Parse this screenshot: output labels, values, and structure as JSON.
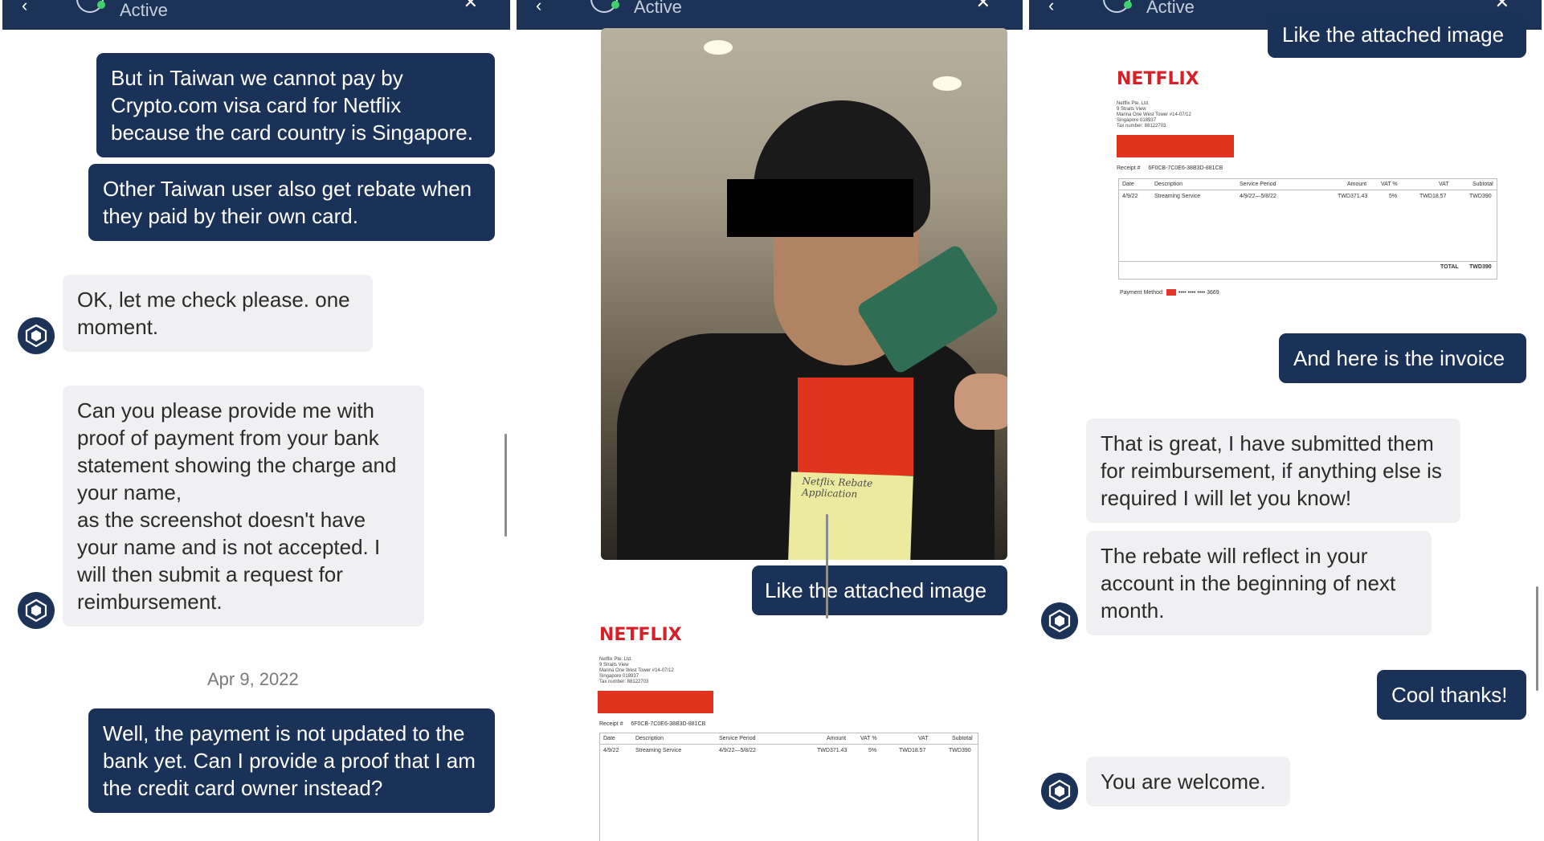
{
  "header": {
    "status": "Active"
  },
  "panel1": {
    "messages": [
      {
        "sender": "user",
        "text": "But in Taiwan we cannot pay by Crypto.com visa card for Netflix because the card country is Singapore."
      },
      {
        "sender": "user",
        "text": "Other Taiwan user also get rebate when they paid by their own card."
      },
      {
        "sender": "agent",
        "text": "OK, let me check please. one moment."
      },
      {
        "sender": "agent",
        "text": "Can you please provide me with proof of payment from your bank statement showing the charge and your name,\nas the screenshot doesn't have your name and is not accepted. I will then submit a request for reimbursement."
      },
      {
        "sender": "user",
        "text": "Well, the payment is not updated to the bank yet. Can I provide a proof that I am the credit card owner instead?"
      }
    ],
    "date_separator": "Apr 9, 2022"
  },
  "panel2": {
    "photo_note_text": "Netflix Rebate Application",
    "messages": [
      {
        "sender": "user",
        "text": "Like the attached image"
      }
    ]
  },
  "panel3": {
    "messages": [
      {
        "sender": "user",
        "text": "Like the attached image"
      },
      {
        "sender": "user",
        "text": "And here is the invoice"
      },
      {
        "sender": "agent",
        "text": "That is great, I have submitted them for reimbursement, if anything else is required I will let you know!"
      },
      {
        "sender": "agent",
        "text": "The rebate will reflect in your account in the beginning of next month."
      },
      {
        "sender": "user",
        "text": "Cool thanks!"
      },
      {
        "sender": "agent",
        "text": "You are welcome."
      }
    ]
  },
  "invoice": {
    "brand": "NETFLIX",
    "address": "Netflix Pte. Ltd.\n9 Straits View\nMarina One West Tower #14-07/12\nSingapore 018937\nTax number: 88122703",
    "receipt_label": "Receipt #",
    "receipt_no": "6F0CB-7C0E6-38B3D-881CB",
    "columns": [
      "Date",
      "Description",
      "Service Period",
      "Amount",
      "VAT %",
      "VAT",
      "Subtotal"
    ],
    "row": [
      "4/9/22",
      "Streaming Service",
      "4/9/22—5/8/22",
      "TWD371.43",
      "5%",
      "TWD18.57",
      "TWD390"
    ],
    "total_label": "TOTAL",
    "total_value": "TWD390",
    "payment_label": "Payment Method:",
    "payment_card": "•••• •••• •••• 3669"
  },
  "colors": {
    "header": "#1c3357",
    "outgoing": "#1b3258",
    "incoming": "#f0f0f2",
    "redaction": "#e0341f"
  },
  "icons": {
    "avatar": "crypto-com-shield-icon"
  }
}
